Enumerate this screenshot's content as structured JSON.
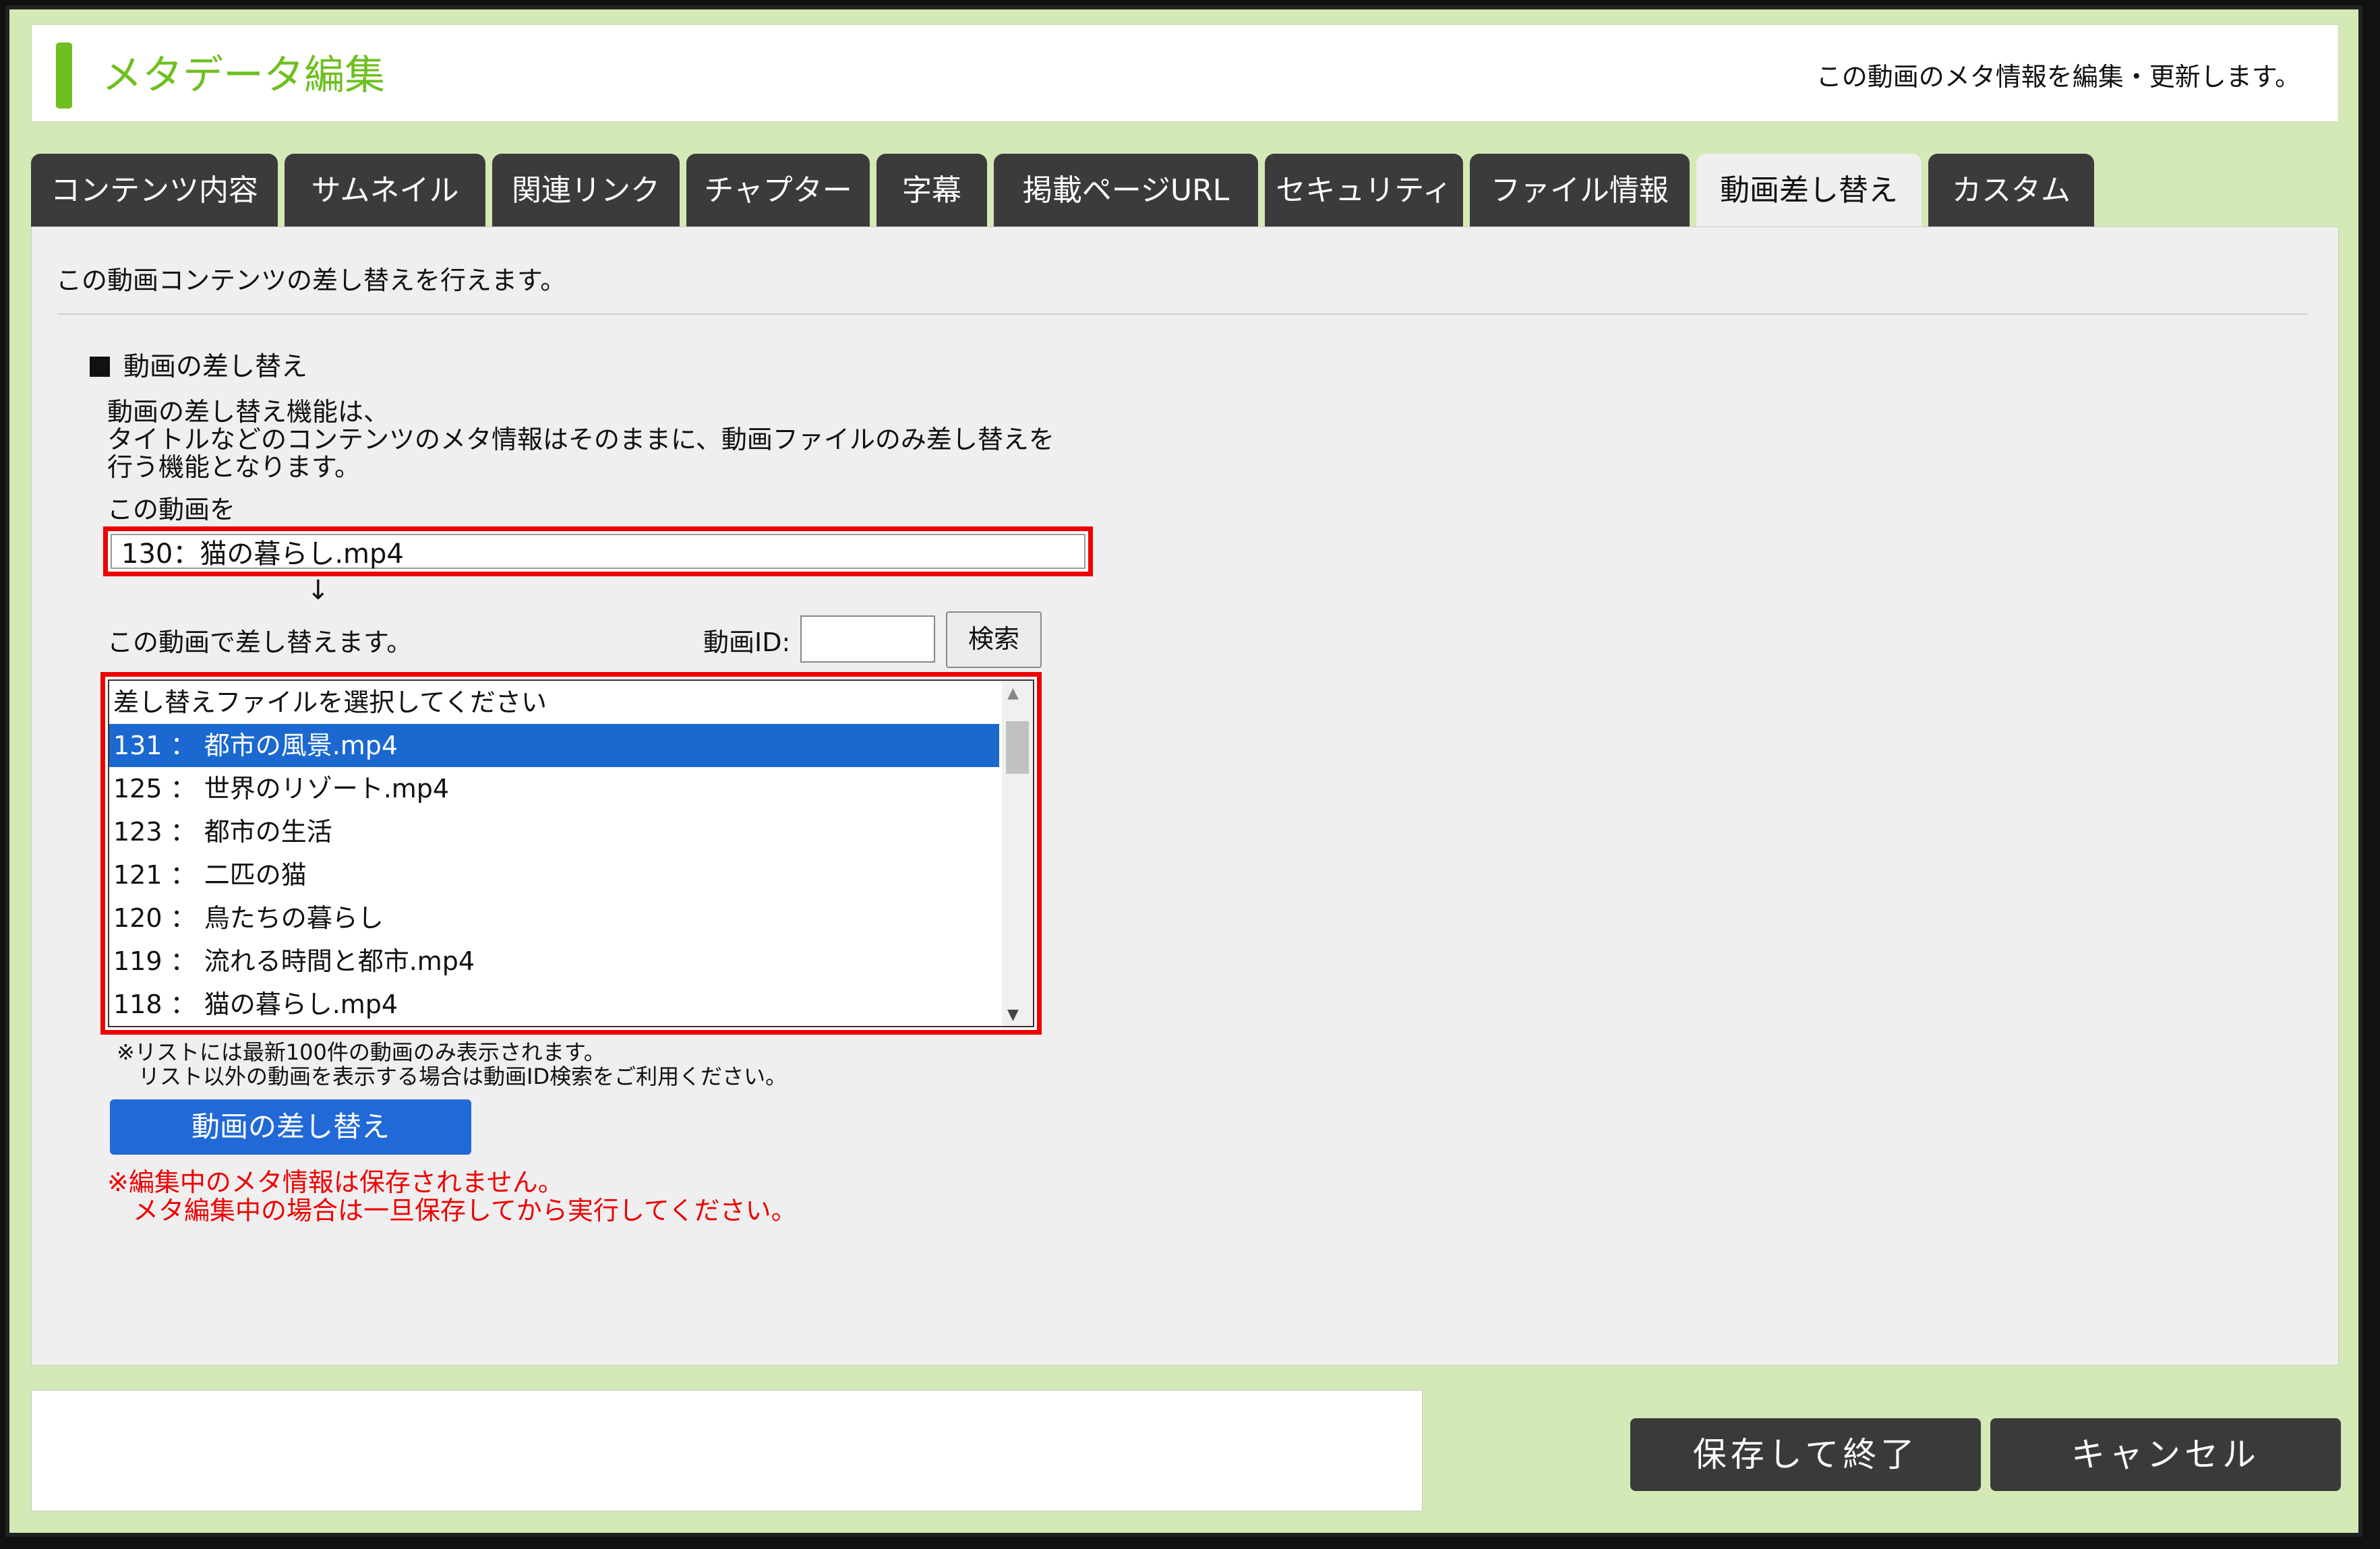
{
  "header": {
    "title": "メタデータ編集",
    "subtitle": "この動画のメタ情報を編集・更新します。"
  },
  "tabs": [
    {
      "label": "コンテンツ内容",
      "active": false
    },
    {
      "label": "サムネイル",
      "active": false
    },
    {
      "label": "関連リンク",
      "active": false
    },
    {
      "label": "チャプター",
      "active": false
    },
    {
      "label": "字幕",
      "active": false
    },
    {
      "label": "掲載ページURL",
      "active": false
    },
    {
      "label": "セキュリティ",
      "active": false
    },
    {
      "label": "ファイル情報",
      "active": false
    },
    {
      "label": "動画差し替え",
      "active": true
    },
    {
      "label": "カスタム",
      "active": false
    }
  ],
  "panel": {
    "intro": "この動画コンテンツの差し替えを行えます。",
    "section_title": "動画の差し替え",
    "description_lines": [
      "動画の差し替え機能は、",
      "タイトルなどのコンテンツのメタ情報はそのままに、動画ファイルのみ差し替えを",
      "行う機能となります。"
    ],
    "source_label": "この動画を",
    "source_video": "130：猫の暮らし.mp4",
    "arrow": "↓",
    "replace_label": "この動画で差し替えます。",
    "id_label": "動画ID:",
    "id_value": "",
    "search_label": "検索",
    "list_items": [
      {
        "text": "差し替えファイルを選択してください",
        "selected": false
      },
      {
        "text": "131 ： 都市の風景.mp4",
        "selected": true
      },
      {
        "text": "125 ： 世界のリゾート.mp4",
        "selected": false
      },
      {
        "text": "123 ： 都市の生活",
        "selected": false
      },
      {
        "text": "121 ： 二匹の猫",
        "selected": false
      },
      {
        "text": "120 ： 鳥たちの暮らし",
        "selected": false
      },
      {
        "text": "119 ： 流れる時間と都市.mp4",
        "selected": false
      },
      {
        "text": "118 ： 猫の暮らし.mp4",
        "selected": false
      }
    ],
    "note_lines": [
      "※リストには最新100件の動画のみ表示されます。",
      "　リスト以外の動画を表示する場合は動画ID検索をご利用ください。"
    ],
    "replace_button": "動画の差し替え",
    "warning_lines": [
      "※編集中のメタ情報は保存されません。",
      "　メタ編集中の場合は一旦保存してから実行してください。"
    ]
  },
  "footer": {
    "save_button": "保存して終了",
    "cancel_button": "キャンセル"
  },
  "colors": {
    "accent_green": "#6ebf1f",
    "frame_bg": "#d3eab6",
    "highlight_red": "#e00000",
    "select_blue": "#1a68d0",
    "tab_dark": "#3b3b3b"
  }
}
